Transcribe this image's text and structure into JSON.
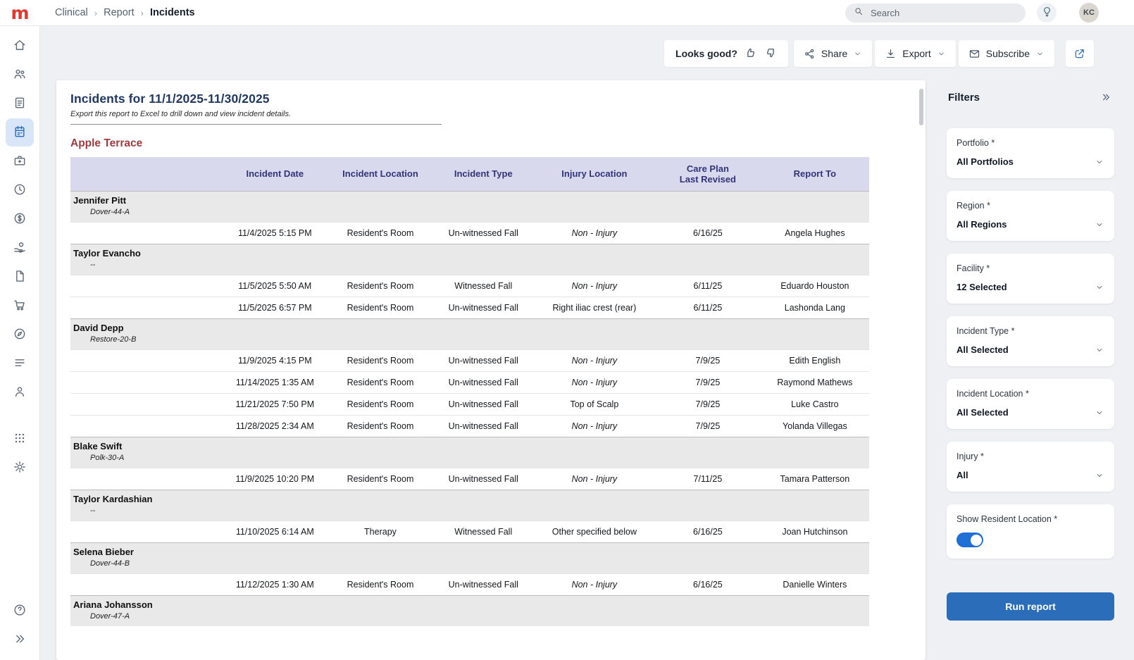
{
  "brand": {
    "logo": "m"
  },
  "colors": {
    "accent": "#2b6db8",
    "title_navy": "#1f3864",
    "section_red": "#a23a40",
    "table_header_bg": "#d9d9ee",
    "table_header_text": "#33337a",
    "toggle_on": "#1f6fd6",
    "logo_red": "#e03a2f"
  },
  "topbar": {
    "breadcrumb": [
      "Clinical",
      "Report",
      "Incidents"
    ],
    "search_placeholder": "Search",
    "avatar_initials": "KC"
  },
  "sidebar": {
    "items": [
      {
        "icon": "home-icon"
      },
      {
        "icon": "people-icon"
      },
      {
        "icon": "reports-icon"
      },
      {
        "icon": "census-icon",
        "active": true
      },
      {
        "icon": "briefcase-icon"
      },
      {
        "icon": "clock-icon"
      },
      {
        "icon": "dollar-icon"
      },
      {
        "icon": "hand-coin-icon"
      },
      {
        "icon": "document-icon"
      },
      {
        "icon": "cart-icon"
      },
      {
        "icon": "compass-icon"
      },
      {
        "icon": "list-icon"
      },
      {
        "icon": "user-icon"
      },
      {
        "icon": "apps-grid-icon"
      },
      {
        "icon": "settings-icon"
      }
    ],
    "footer_items": [
      {
        "icon": "help-icon"
      },
      {
        "icon": "expand-icon"
      }
    ]
  },
  "toolbar": {
    "feedback_label": "Looks good?",
    "share_label": "Share",
    "export_label": "Export",
    "subscribe_label": "Subscribe"
  },
  "report": {
    "title": "Incidents for 11/1/2025-11/30/2025",
    "subtitle": "Export this report to Excel to drill down and view incident details.",
    "section_title": "Apple Terrace",
    "columns": [
      "",
      "Incident Date",
      "Incident Location",
      "Incident Type",
      "Injury Location",
      "Care Plan\nLast Revised",
      "Report To"
    ],
    "groups": [
      {
        "name": "Jennifer Pitt",
        "unit": "Dover-44-A",
        "rows": [
          [
            "11/4/2025 5:15 PM",
            "Resident's Room",
            "Un-witnessed Fall",
            "Non - Injury",
            "6/16/25",
            "Angela Hughes"
          ]
        ]
      },
      {
        "name": "Taylor Evancho",
        "unit": "--",
        "rows": [
          [
            "11/5/2025 5:50 AM",
            "Resident's Room",
            "Witnessed Fall",
            "Non - Injury",
            "6/11/25",
            "Eduardo Houston"
          ],
          [
            "11/5/2025 6:57 PM",
            "Resident's Room",
            "Un-witnessed Fall",
            "Right iliac crest (rear)",
            "6/11/25",
            "Lashonda Lang"
          ]
        ]
      },
      {
        "name": "David Depp",
        "unit": "Restore-20-B",
        "rows": [
          [
            "11/9/2025 4:15 PM",
            "Resident's Room",
            "Un-witnessed Fall",
            "Non - Injury",
            "7/9/25",
            "Edith English"
          ],
          [
            "11/14/2025 1:35 AM",
            "Resident's Room",
            "Un-witnessed Fall",
            "Non - Injury",
            "7/9/25",
            "Raymond Mathews"
          ],
          [
            "11/21/2025 7:50 PM",
            "Resident's Room",
            "Un-witnessed Fall",
            "Top of Scalp",
            "7/9/25",
            "Luke Castro"
          ],
          [
            "11/28/2025 2:34 AM",
            "Resident's Room",
            "Un-witnessed Fall",
            "Non - Injury",
            "7/9/25",
            "Yolanda Villegas"
          ]
        ]
      },
      {
        "name": "Blake Swift",
        "unit": "Polk-30-A",
        "rows": [
          [
            "11/9/2025 10:20 PM",
            "Resident's Room",
            "Un-witnessed Fall",
            "Non - Injury",
            "7/11/25",
            "Tamara Patterson"
          ]
        ]
      },
      {
        "name": "Taylor Kardashian",
        "unit": "--",
        "rows": [
          [
            "11/10/2025 6:14 AM",
            "Therapy",
            "Witnessed Fall",
            "Other specified below",
            "6/16/25",
            "Joan Hutchinson"
          ]
        ]
      },
      {
        "name": "Selena Bieber",
        "unit": "Dover-44-B",
        "rows": [
          [
            "11/12/2025 1:30 AM",
            "Resident's Room",
            "Un-witnessed Fall",
            "Non - Injury",
            "6/16/25",
            "Danielle Winters"
          ]
        ]
      },
      {
        "name": "Ariana Johansson",
        "unit": "Dover-47-A",
        "rows": []
      }
    ]
  },
  "filters": {
    "title": "Filters",
    "items": [
      {
        "label": "Portfolio",
        "required": true,
        "type": "select",
        "value": "All Portfolios"
      },
      {
        "label": "Region",
        "required": true,
        "type": "select",
        "value": "All Regions"
      },
      {
        "label": "Facility",
        "required": true,
        "type": "select",
        "value": "12 Selected"
      },
      {
        "label": "Incident Type",
        "required": true,
        "type": "select",
        "value": "All Selected"
      },
      {
        "label": "Incident Location",
        "required": true,
        "type": "select",
        "value": "All Selected"
      },
      {
        "label": "Injury",
        "required": true,
        "type": "select",
        "value": "All"
      },
      {
        "label": "Show Resident Location",
        "required": true,
        "type": "toggle",
        "value": true
      }
    ],
    "run_button_label": "Run report"
  }
}
